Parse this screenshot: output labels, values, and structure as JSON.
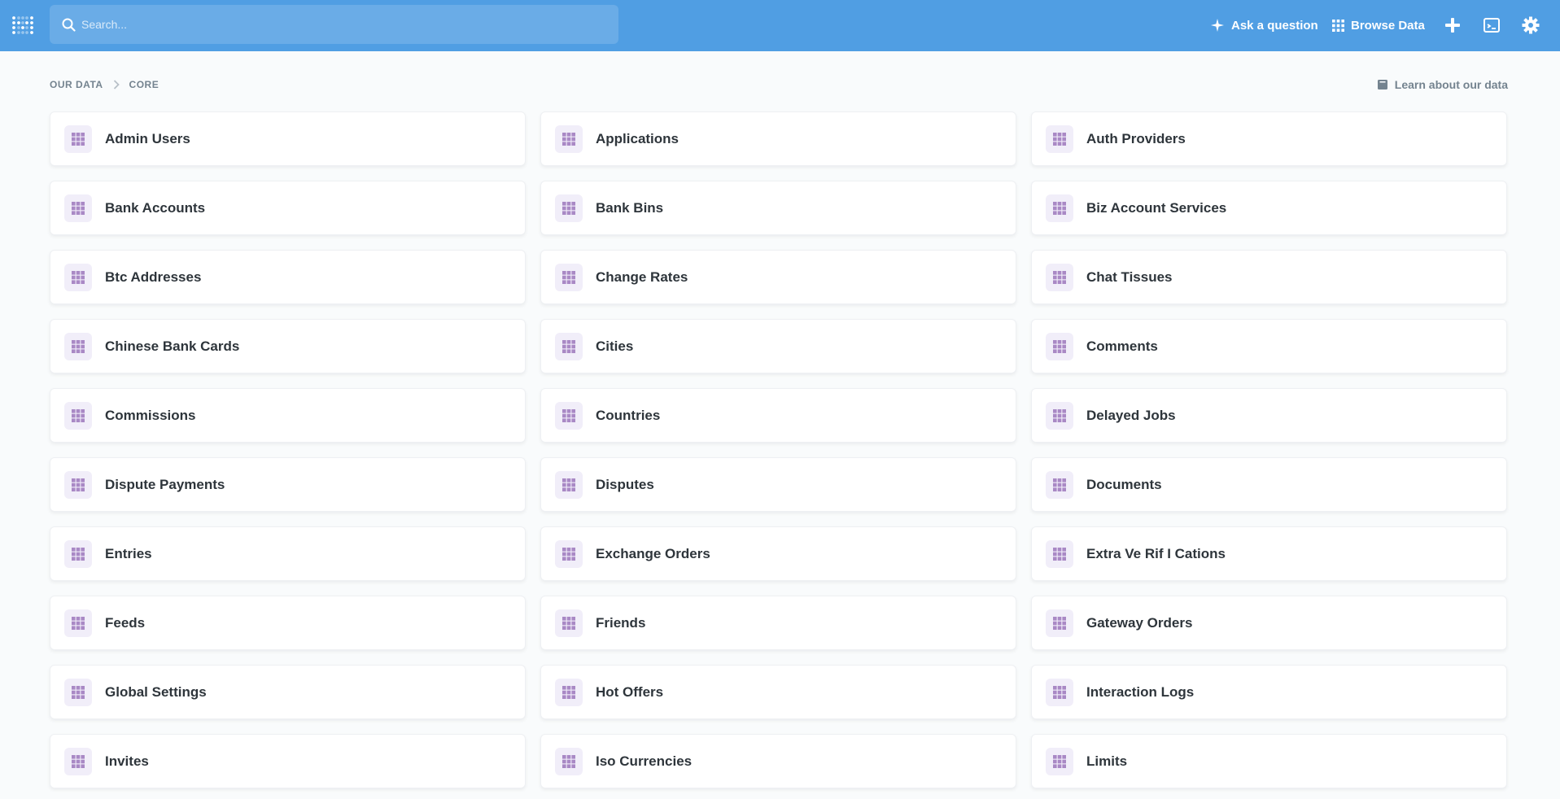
{
  "header": {
    "search_placeholder": "Search...",
    "ask_question": "Ask a question",
    "browse_data": "Browse Data"
  },
  "breadcrumb": {
    "root": "OUR DATA",
    "current": "CORE"
  },
  "learn_link": "Learn about our data",
  "colors": {
    "brand": "#509ee3",
    "table_icon": "#a989c5"
  },
  "tables": [
    {
      "name": "Admin Users"
    },
    {
      "name": "Applications"
    },
    {
      "name": "Auth Providers"
    },
    {
      "name": "Bank Accounts"
    },
    {
      "name": "Bank Bins"
    },
    {
      "name": "Biz Account Services"
    },
    {
      "name": "Btc Addresses"
    },
    {
      "name": "Change Rates"
    },
    {
      "name": "Chat Tissues"
    },
    {
      "name": "Chinese Bank Cards"
    },
    {
      "name": "Cities"
    },
    {
      "name": "Comments"
    },
    {
      "name": "Commissions"
    },
    {
      "name": "Countries"
    },
    {
      "name": "Delayed Jobs"
    },
    {
      "name": "Dispute Payments"
    },
    {
      "name": "Disputes"
    },
    {
      "name": "Documents"
    },
    {
      "name": "Entries"
    },
    {
      "name": "Exchange Orders"
    },
    {
      "name": "Extra Ve Rif I Cations"
    },
    {
      "name": "Feeds"
    },
    {
      "name": "Friends"
    },
    {
      "name": "Gateway Orders"
    },
    {
      "name": "Global Settings"
    },
    {
      "name": "Hot Offers"
    },
    {
      "name": "Interaction Logs"
    },
    {
      "name": "Invites"
    },
    {
      "name": "Iso Currencies"
    },
    {
      "name": "Limits"
    }
  ]
}
